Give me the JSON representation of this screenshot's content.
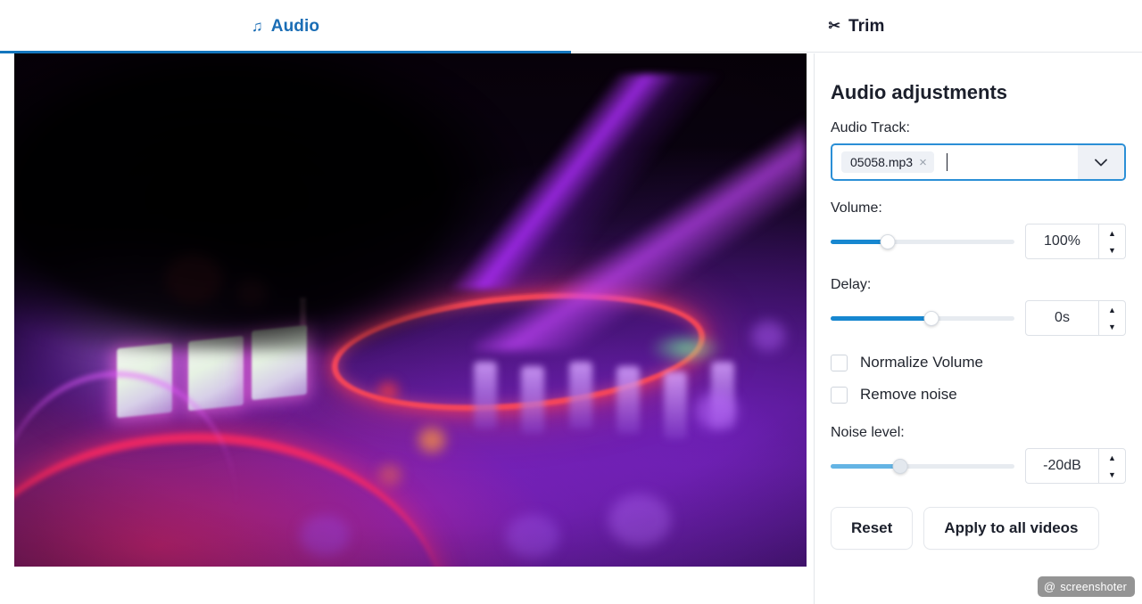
{
  "tabs": [
    {
      "label": "Audio",
      "icon": "music-note-icon",
      "glyph": "♫",
      "active": true
    },
    {
      "label": "Trim",
      "icon": "scissors-icon",
      "glyph": "✂",
      "active": false
    }
  ],
  "preview": {
    "alt": "DJ controller with neon purple and pink lighting, hand above jog wheel"
  },
  "panel": {
    "title": "Audio adjustments",
    "audio_track": {
      "label": "Audio Track:",
      "chip": "05058.mp3",
      "remove_glyph": "×",
      "caret_glyph": "⌄",
      "placeholder": ""
    },
    "volume": {
      "label": "Volume:",
      "value": "100%",
      "percent": 31,
      "up_glyph": "▲",
      "down_glyph": "▼"
    },
    "delay": {
      "label": "Delay:",
      "value": "0s",
      "percent": 55,
      "up_glyph": "▲",
      "down_glyph": "▼"
    },
    "normalize": {
      "label": "Normalize Volume",
      "checked": false
    },
    "remove_noise": {
      "label": "Remove noise",
      "checked": false
    },
    "noise_level": {
      "label": "Noise level:",
      "value": "-20dB",
      "percent": 38,
      "disabled": true,
      "up_glyph": "▲",
      "down_glyph": "▼"
    },
    "buttons": {
      "reset": "Reset",
      "apply_all": "Apply to all videos"
    }
  },
  "watermark": {
    "at": "@",
    "text": "screenshoter"
  },
  "colors": {
    "accent": "#1476bd",
    "slider_fill": "#1787d0",
    "slider_fill_disabled": "#64b4e4",
    "track": "#e7ebf0",
    "focus_border": "#2b8fd6",
    "text": "#1b1f2b"
  }
}
